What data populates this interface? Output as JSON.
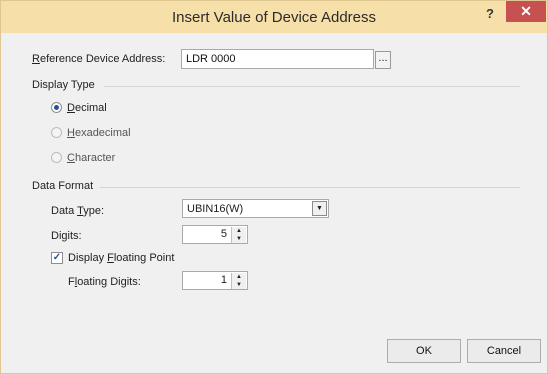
{
  "window": {
    "title": "Insert Value of Device Address",
    "help_label": "?",
    "close_label": "✕"
  },
  "reference": {
    "label_accel": "R",
    "label_rest": "eference Device Address:",
    "value": "LDR 0000",
    "browse_label": "..."
  },
  "display_type": {
    "heading": "Display Type",
    "options": [
      {
        "accel": "D",
        "rest": "ecimal",
        "checked": true,
        "enabled": true
      },
      {
        "accel": "H",
        "rest": "exadecimal",
        "checked": false,
        "enabled": false
      },
      {
        "accel": "C",
        "rest": "haracter",
        "checked": false,
        "enabled": false
      }
    ]
  },
  "data_format": {
    "heading": "Data Format",
    "data_type_pre": "Data ",
    "data_type_accel": "T",
    "data_type_post": "ype:",
    "data_type_value": "UBIN16(W)",
    "digits_pre": "Di",
    "digits_accel": "g",
    "digits_post": "its:",
    "digits_value": "5",
    "display_fp_pre": "Display ",
    "display_fp_accel": "F",
    "display_fp_post": "loating Point",
    "display_fp_checked": true,
    "fp_digits_pre": "F",
    "fp_digits_accel": "l",
    "fp_digits_post": "oating Digits:",
    "fp_digits_value": "1"
  },
  "buttons": {
    "ok": "OK",
    "cancel": "Cancel"
  }
}
